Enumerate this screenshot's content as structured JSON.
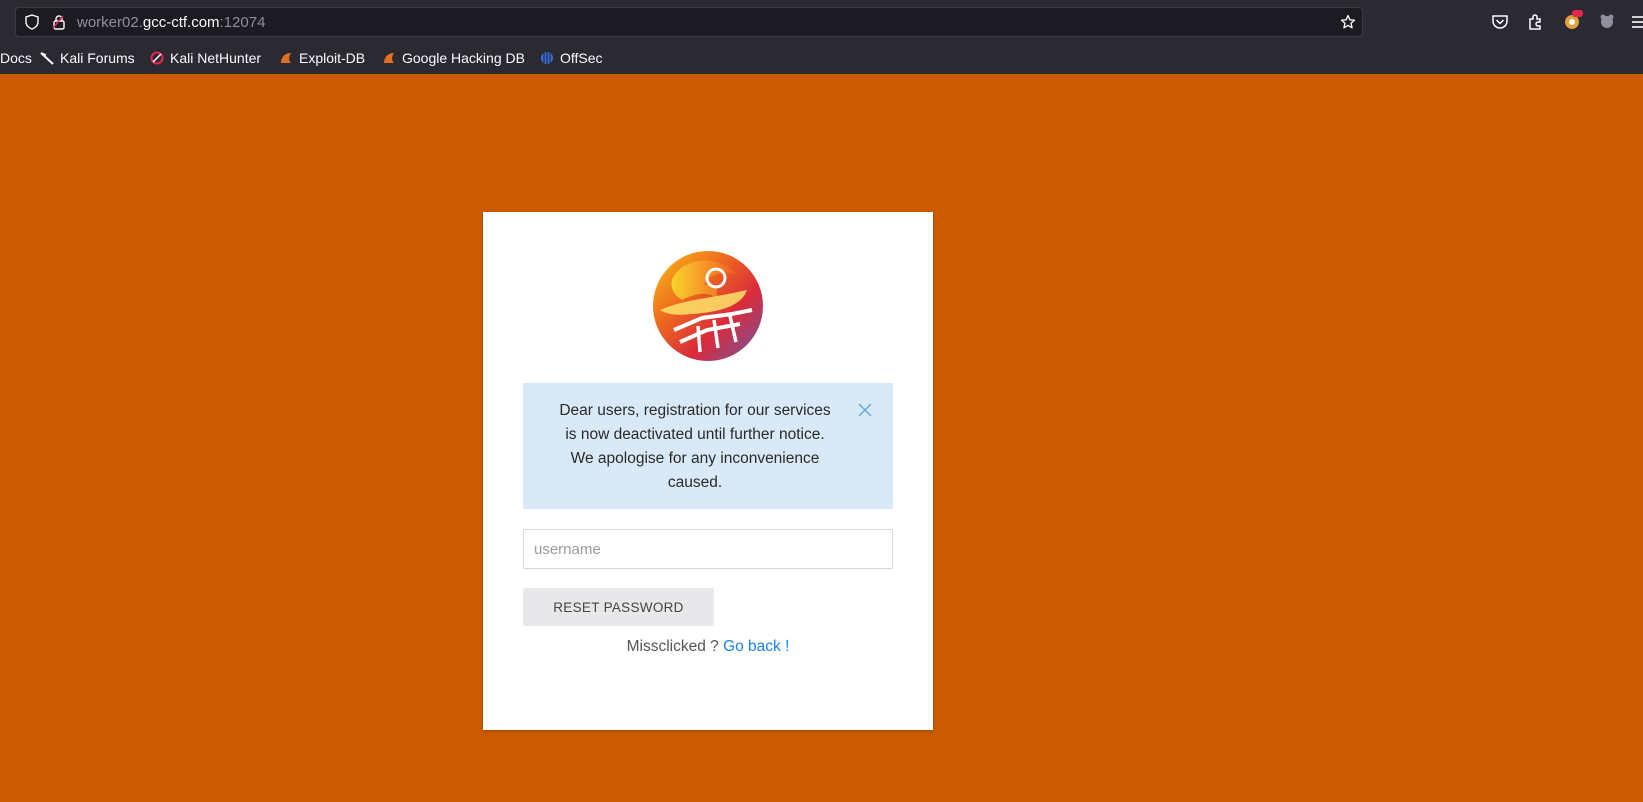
{
  "browser": {
    "url_prefix": "worker02.",
    "url_host": "gcc-ctf.com",
    "url_port": ":12074",
    "bookmarks": [
      {
        "label": "Docs",
        "icon": "kali-docs-icon"
      },
      {
        "label": "Kali Forums",
        "icon": "kali-dragon-icon"
      },
      {
        "label": "Kali NetHunter",
        "icon": "nethunter-icon"
      },
      {
        "label": "Exploit-DB",
        "icon": "exploit-db-icon"
      },
      {
        "label": "Google Hacking DB",
        "icon": "ghdb-icon"
      },
      {
        "label": "OffSec",
        "icon": "offsec-icon"
      }
    ]
  },
  "page": {
    "background_color": "#cc5a00",
    "alert": {
      "line1": "Dear users, registration for our services",
      "line2": "is now deactivated until further notice.",
      "line3": "We apologise for any inconvenience",
      "line4": "caused."
    },
    "username_placeholder": "username",
    "reset_button_label": "RESET PASSWORD",
    "footer_text": "Missclicked ? ",
    "footer_link": "Go back !"
  }
}
